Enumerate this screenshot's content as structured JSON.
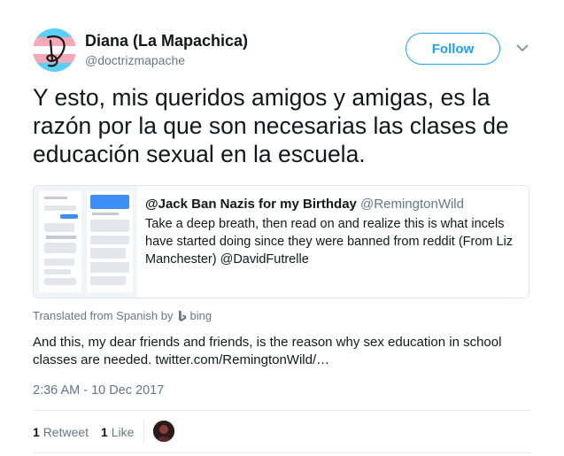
{
  "author": {
    "name": "Diana (La Mapachica)",
    "handle": "@doctrizmapache",
    "avatar_flag_colors": [
      "#5bcefa",
      "#f5a9b8",
      "#ffffff"
    ]
  },
  "actions": {
    "follow_label": "Follow",
    "more_icon": "chevron-down-icon"
  },
  "tweet": {
    "text": "Y esto, mis queridos amigos y amigas, es la razón por la que son necesarias las clases de educación sexual en la escuela."
  },
  "quoted_tweet": {
    "name": "@Jack Ban Nazis for my Birthday",
    "handle": "@RemingtonWild",
    "text": "Take a deep breath, then read on and realize this is what incels have started doing since they were banned from reddit (From Liz Manchester) @DavidFutrelle"
  },
  "translation": {
    "label": "Translated from Spanish by",
    "provider": "bing",
    "text": "And this, my dear friends and friends, is the reason why sex education in school classes are needed. twitter.com/RemingtonWild/…"
  },
  "timestamp": "2:36 AM - 10 Dec 2017",
  "stats": {
    "retweets_count": "1",
    "retweets_label": "Retweet",
    "likes_count": "1",
    "likes_label": "Like"
  },
  "colors": {
    "accent": "#1da1f2",
    "secondary_text": "#657786",
    "border": "#e1e8ed"
  }
}
